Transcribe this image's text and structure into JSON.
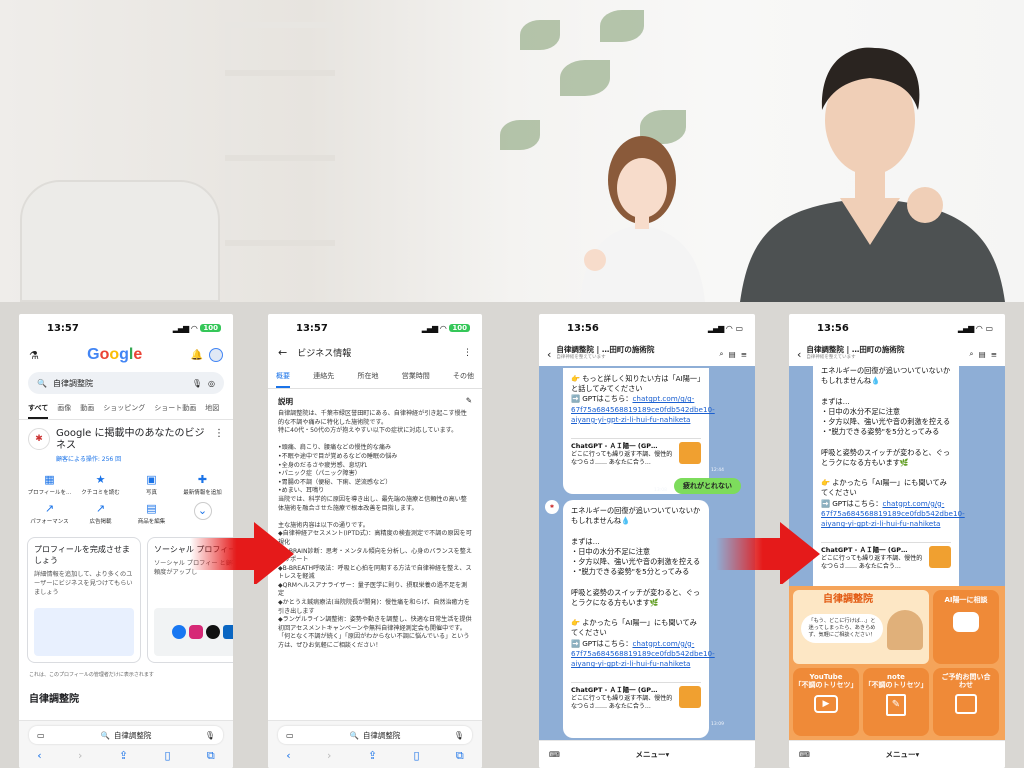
{
  "colors": {
    "google_blue": "#1a73e8",
    "line_chat_bg": "#8eaed6",
    "line_green": "#7ddc5c",
    "rich_orange": "#ef8a38",
    "arrow_red": "#e51a1a"
  },
  "phone1": {
    "time": "13:57",
    "battery": "100",
    "logo": [
      "G",
      "o",
      "o",
      "g",
      "l",
      "e"
    ],
    "search_query": "自律調整院",
    "tabs": [
      "すべて",
      "画像",
      "動画",
      "ショッピング",
      "ショート動画",
      "地図"
    ],
    "biz_title": "Google に掲載中のあなたのビジネス",
    "biz_sub": "顧客による操作: 256 回",
    "actions": [
      {
        "icon": "store-icon",
        "glyph": "▦",
        "label": "プロフィールを..."
      },
      {
        "icon": "review-icon",
        "glyph": "★",
        "label": "クチコミを読む"
      },
      {
        "icon": "photo-icon",
        "glyph": "▣",
        "label": "写真"
      },
      {
        "icon": "add-post-icon",
        "glyph": "✚",
        "label": "最新情報を追加"
      },
      {
        "icon": "trend-icon",
        "glyph": "↗",
        "label": "パフォーマンス"
      },
      {
        "icon": "ads-icon",
        "glyph": "↗",
        "label": "広告掲載"
      },
      {
        "icon": "bag-icon",
        "glyph": "▤",
        "label": "商品を編集"
      },
      {
        "icon": "more-icon",
        "glyph": "⌄",
        "label": ""
      }
    ],
    "card1_title": "プロフィールを完成させましょう",
    "card1_desc": "詳細情報を追加して、より多くのユーザーにビジネスを見つけてもらいましょう",
    "card2_title": "ソーシャル プロフィー",
    "card2_desc": "ソーシャル プロフィー と顧客の信頼度がアップし",
    "note": "これは、このプロフィールの管理者だけに表示されます",
    "section_title": "自律調整院",
    "url": "自律調整院"
  },
  "phone2": {
    "time": "13:57",
    "battery": "100",
    "title": "ビジネス情報",
    "tabs": [
      "概要",
      "連絡先",
      "所在地",
      "営業時間",
      "その他"
    ],
    "desc_heading": "説明",
    "description": "自律調整院は、千葉市緑区誉田町にある、自律神経が引き起こす慢性的な不調や痛みに特化した施術院です。\n特に40代・50代の方が抱えやすい以下の症状に対応しています。\n\n•頭痛、肩こり、腰痛などの慢性的な痛み\n•不眠や途中で目が覚めるなどの睡眠の悩み\n•全身のだるさや疲労感、息切れ\n•パニック症（パニック障害）\n•胃腸の不調（便秘、下痢、逆流感など）\n•めまい、耳鳴り\n当院では、科学的に原因を導き出し、最先端の施療と信頼性の高い整体施術を融合させた施療で根本改善を目指します。\n\n主な施術内容は以下の通りです。\n◆自律神経アセスメント(IPTD式)：高精度の検査測定で不調の原因を可視化\n◆B-BRAIN診断：思考・メンタル傾向を分析し、心身のバランスを整えるサポート\n◆B-BREATH呼吸法：呼吸と心拍を同期する方法で自律神経を整え、ストレスを軽減\n◆QRMヘルスアナライザー：量子医学に則り、摂取栄養の過不足を測定\n◆かとうえ鍼病療法(当院院長が開発)：慢性痛を和らげ、自然治癒力を引き出します\n◆ランゲルライン調整術：姿勢や動きを調整し、快適な日常生活を提供\n初回アセスメントキャンペーンや無料自律神経測定会も開催中です。\n「何となく不調が続く」「原因がわからない不調に悩んでいる」という方は、ぜひお気軽にご相談ください！",
    "url": "自律調整院"
  },
  "phone3": {
    "time": "13:56",
    "header_name": "自律調整院 | …田町の施術院",
    "header_sub": "自律神経を整えています",
    "msg1": "👉 もっと詳しく知りたい方は「AI陽一」と話してみてください\n➡️ GPTはこちら：",
    "msg1_link": "chatgpt.com/g/g-67f75a684568819189ce0fdb542dbe10-aiyang-yi-gpt-zi-li-hui-fu-nahiketa",
    "gpt_title": "ChatGPT - ＡＩ陽一 (GP…",
    "gpt_desc": "どこに行っても繰り返す不調、慢性的なつらさ…… あなたに合う…",
    "time1": "12:44",
    "user_msg": "疲れがとれない",
    "time_user": "13:08",
    "msg2": "エネルギーの回復が追いついていないかもしれませんね💧\n\nまずは…\n・日中の水分不足に注意\n・夕方以降、強い光や音の刺激を控える\n・\"脱力できる姿勢\"を5分とってみる\n\n呼吸と姿勢のスイッチが変わると、ぐっとラクになる方もいます🌿\n\n👉 よかったら「AI陽一」にも聞いてみてください\n➡️ GPTはこちら：",
    "msg2_link": "chatgpt.com/g/g-67f75a684568819189ce0fdb542dbe10-aiyang-yi-gpt-zi-li-hui-fu-nahiketa",
    "time2": "13:09",
    "footer_menu": "メニュー▾"
  },
  "phone4": {
    "time": "13:56",
    "header_name": "自律調整院 | …田町の施術院",
    "header_sub": "自律神経を整えています",
    "msg": "エネルギーの回復が追いついていないかもしれませんね💧\n\nまずは…\n・日中の水分不足に注意\n・夕方以降、強い光や音の刺激を控える\n・\"脱力できる姿勢\"を5分とってみる\n\n呼吸と姿勢のスイッチが変わると、ぐっとラクになる方もいます🌿\n\n👉 よかったら「AI陽一」にも聞いてみてください\n➡️ GPTはこちら：",
    "msg_link": "chatgpt.com/g/g-67f75a684568819189ce0fdb542dbe10-aiyang-yi-gpt-zi-li-hui-fu-nahiketa",
    "gpt_title": "ChatGPT - ＡＩ陽一 (GP…",
    "gpt_desc": "どこに行っても繰り返す不調、慢性的なつらさ…… あなたに合う…",
    "rich_title": "自律調整院",
    "rich_bubble": "「もう、どこに行けば…」と迷ってしまったら、あきらめず、気軽にご相談ください！",
    "rich_ai": "AI陽一に相談",
    "rich_yt1": "YouTube",
    "rich_yt2": "「不調のトリセツ」",
    "rich_note1": "note",
    "rich_note2": "「不調のトリセツ」",
    "rich_book": "ご予約お問い合わせ",
    "footer_menu": "メニュー▾"
  }
}
